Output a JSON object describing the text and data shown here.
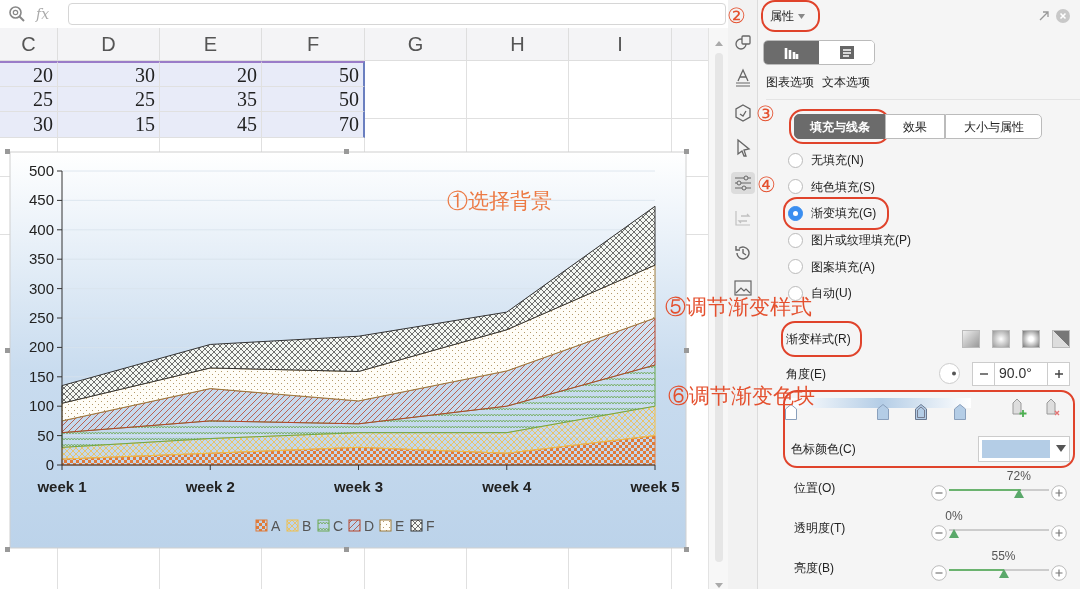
{
  "formula_bar": {
    "fx": "fx"
  },
  "sheet": {
    "columns": [
      "C",
      "D",
      "E",
      "F",
      "G",
      "H",
      "I"
    ],
    "rows": [
      {
        "cells": [
          "20",
          "30",
          "20",
          "50"
        ],
        "selected": true
      },
      {
        "cells": [
          "25",
          "25",
          "35",
          "50"
        ],
        "selected": true
      },
      {
        "cells": [
          "30",
          "15",
          "45",
          "70"
        ],
        "selected": true
      }
    ]
  },
  "chart": {
    "selected": true,
    "chart_data": {
      "type": "area",
      "stacked": true,
      "grid": true,
      "legend": true,
      "categories": [
        "week 1",
        "week 2",
        "week 3",
        "week 4",
        "week 5"
      ],
      "ylim": [
        0,
        500
      ],
      "yticks": [
        0,
        50,
        100,
        150,
        200,
        250,
        300,
        350,
        400,
        450,
        500
      ],
      "series": [
        {
          "name": "A",
          "color": "#e07b39",
          "values": [
            10,
            20,
            30,
            20,
            50
          ]
        },
        {
          "name": "B",
          "color": "#f0bf4c",
          "values": [
            20,
            25,
            25,
            35,
            50
          ]
        },
        {
          "name": "C",
          "color": "#6aa84f",
          "values": [
            25,
            30,
            15,
            45,
            70
          ]
        },
        {
          "name": "D",
          "color": "#b5452c",
          "values": [
            20,
            55,
            39,
            60,
            80
          ]
        },
        {
          "name": "E",
          "color": "#9c7a3c",
          "values": [
            30,
            35,
            50,
            70,
            90
          ]
        },
        {
          "name": "F",
          "color": "#333333",
          "values": [
            30,
            40,
            60,
            30,
            100
          ]
        }
      ]
    }
  },
  "annotations": [
    {
      "text": "①选择背景"
    },
    {
      "text": "②"
    },
    {
      "text": "③"
    },
    {
      "text": "④"
    },
    {
      "text": "⑤调节渐变样式"
    },
    {
      "text": "⑥调节渐变色块"
    }
  ],
  "side_toolbar": [
    {
      "kind": "shapes",
      "selected": false,
      "disabled": false
    },
    {
      "kind": "text-style",
      "selected": false,
      "disabled": false
    },
    {
      "kind": "hexagon",
      "selected": false,
      "disabled": false
    },
    {
      "kind": "cursor",
      "selected": false,
      "disabled": false
    },
    {
      "kind": "sliders",
      "selected": true,
      "disabled": false
    },
    {
      "kind": "swap",
      "selected": false,
      "disabled": true
    },
    {
      "kind": "history",
      "selected": false,
      "disabled": false
    },
    {
      "kind": "image",
      "selected": false,
      "disabled": false
    }
  ],
  "panel": {
    "title": "属性",
    "circled": true,
    "view_toggle": [
      {
        "kind": "chart",
        "selected": true
      },
      {
        "kind": "text",
        "selected": false
      }
    ],
    "view_labels": [
      "图表选项",
      "文本选项"
    ],
    "tabs": [
      {
        "label": "填充与线条",
        "selected": true,
        "circled": true
      },
      {
        "label": "效果",
        "selected": false,
        "circled": false
      },
      {
        "label": "大小与属性",
        "selected": false,
        "circled": false
      }
    ],
    "fill_options": [
      {
        "label": "无填充(N)",
        "selected": false,
        "circled": false
      },
      {
        "label": "纯色填充(S)",
        "selected": false,
        "circled": false
      },
      {
        "label": "渐变填充(G)",
        "selected": true,
        "circled": true
      },
      {
        "label": "图片或纹理填充(P)",
        "selected": false,
        "circled": false
      },
      {
        "label": "图案填充(A)",
        "selected": false,
        "circled": false
      },
      {
        "label": "自动(U)",
        "selected": false,
        "circled": false
      }
    ],
    "gradient_style": {
      "label": "渐变样式(R)",
      "circled": true
    },
    "angle": {
      "label": "角度(E)",
      "value": "90.0°"
    },
    "gradient": {
      "circled": true,
      "stops": [
        {
          "level": 0,
          "selected": false
        },
        {
          "level": 0.51,
          "selected": false
        },
        {
          "level": 0.72,
          "selected": true
        },
        {
          "level": 0.94,
          "selected": false
        }
      ],
      "stop_color_label": "色标颜色(C)"
    },
    "sliders": [
      {
        "label": "位置(O)",
        "reading": "72%",
        "level": 0.72
      },
      {
        "label": "透明度(T)",
        "reading": "0%",
        "level": 0
      },
      {
        "label": "亮度(B)",
        "reading": "55%",
        "level": 0.55
      }
    ]
  }
}
